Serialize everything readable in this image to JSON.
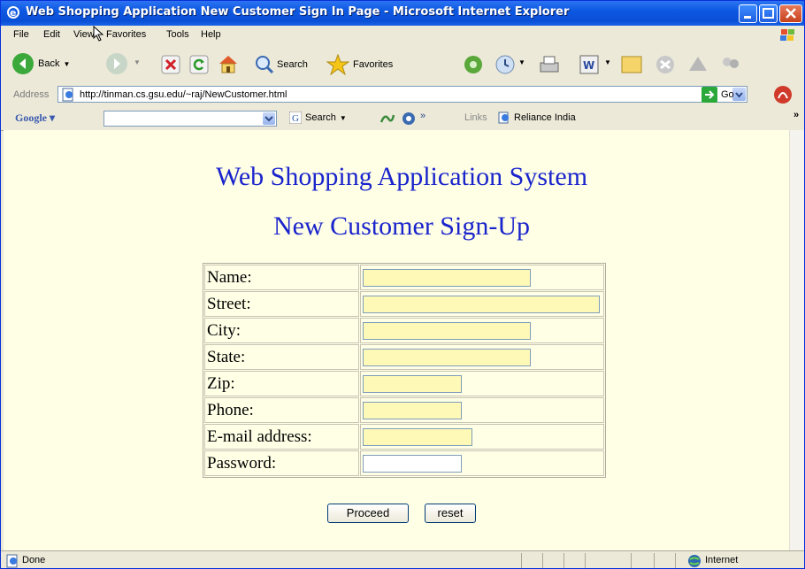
{
  "window": {
    "title": "Web Shopping Application New Customer Sign In Page - Microsoft Internet Explorer"
  },
  "menu": [
    "File",
    "Edit",
    "View",
    "Favorites",
    "Tools",
    "Help"
  ],
  "toolbar": {
    "back": "Back",
    "search": "Search",
    "favorites": "Favorites"
  },
  "address": {
    "label": "Address",
    "url": "http://tinman.cs.gsu.edu/~raj/NewCustomer.html",
    "go": "Go"
  },
  "googlebar": {
    "brand": "Google",
    "search": "Search",
    "chevron": "»",
    "links": "Links",
    "link1": "Reliance India",
    "more": "»"
  },
  "page": {
    "heading": "Web Shopping Application System",
    "subheading": "New Customer Sign-Up",
    "fields": [
      {
        "label": "Name:",
        "value": ""
      },
      {
        "label": "Street:",
        "value": ""
      },
      {
        "label": "City:",
        "value": ""
      },
      {
        "label": "State:",
        "value": ""
      },
      {
        "label": "Zip:",
        "value": ""
      },
      {
        "label": "Phone:",
        "value": ""
      },
      {
        "label": "E-mail address:",
        "value": ""
      },
      {
        "label": "Password:",
        "value": ""
      }
    ],
    "proceed": "Proceed",
    "reset": "reset"
  },
  "status": {
    "text": "Done",
    "zone": "Internet"
  },
  "colors": {
    "heading": "#1a24cc",
    "page_background": "#ffffe6",
    "input_fill": "#fff9b8"
  }
}
